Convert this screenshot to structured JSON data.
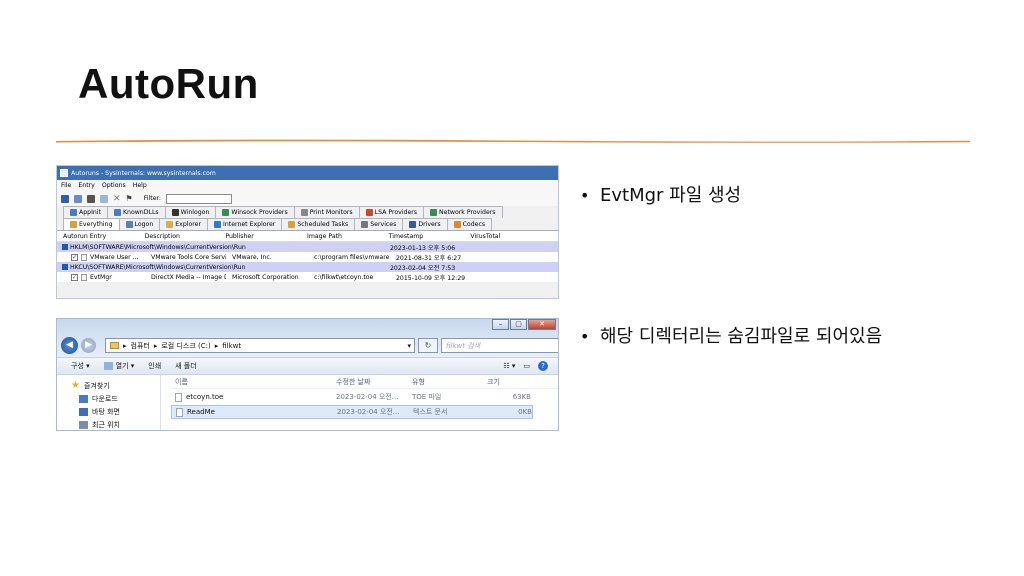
{
  "slide": {
    "title": "AutoRun",
    "bullets": [
      "EvtMgr 파일 생성",
      "해당 디렉터리는 숨김파일로 되어있음"
    ],
    "accent_color": "#ec8a3c"
  },
  "autoruns": {
    "window_title": "Autoruns - Sysinternals: www.sysinternals.com",
    "menu": [
      "File",
      "Entry",
      "Options",
      "Help"
    ],
    "filter_label": "Filter:",
    "filter_value": "",
    "tabs_row1": [
      "AppInit",
      "KnownDLLs",
      "Winlogon",
      "Winsock Providers",
      "Print Monitors",
      "LSA Providers",
      "Network Providers"
    ],
    "tabs_row2": [
      "Everything",
      "Logon",
      "Explorer",
      "Internet Explorer",
      "Scheduled Tasks",
      "Services",
      "Drivers",
      "Codecs"
    ],
    "columns": [
      "Autorun Entry",
      "Description",
      "Publisher",
      "Image Path",
      "Timestamp",
      "VirusTotal"
    ],
    "key1": {
      "path": "HKLM\\SOFTWARE\\Microsoft\\Windows\\CurrentVersion\\Run",
      "timestamp": "2023-01-13 오후 5:06"
    },
    "row1": {
      "entry": "VMware User ...",
      "description": "VMware Tools Core Service",
      "publisher": "VMware, Inc.",
      "image_path": "c:\\program files\\vmware...",
      "timestamp": "2021-08-31 오후 6:27"
    },
    "key2": {
      "path": "HKCU\\SOFTWARE\\Microsoft\\Windows\\CurrentVersion\\Run",
      "timestamp": "2023-02-04 오전 7:53"
    },
    "row2": {
      "entry": "EvtMgr",
      "description": "DirectX Media -- Image Dire...",
      "publisher": "Microsoft Corporation",
      "image_path": "c:\\filkwt\\etcoyn.toe",
      "timestamp": "2015-10-09 오후 12:29"
    }
  },
  "explorer": {
    "breadcrumb": [
      "컴퓨터",
      "로컬 디스크 (C:)",
      "filkwt"
    ],
    "search_placeholder": "filkwt 검색",
    "commands": [
      "구성 ▾",
      "열기 ▾",
      "인쇄",
      "새 폴더"
    ],
    "nav": [
      "즐겨찾기",
      "다운로드",
      "바탕 화면",
      "최근 위치"
    ],
    "columns": [
      "이름",
      "수정한 날짜",
      "유형",
      "크기"
    ],
    "files": [
      {
        "name": "etcoyn.toe",
        "modified": "2023-02-04 오전...",
        "type": "TOE 파일",
        "size": "63KB"
      },
      {
        "name": "ReadMe",
        "modified": "2023-02-04 오전...",
        "type": "텍스트 문서",
        "size": "0KB"
      }
    ]
  }
}
